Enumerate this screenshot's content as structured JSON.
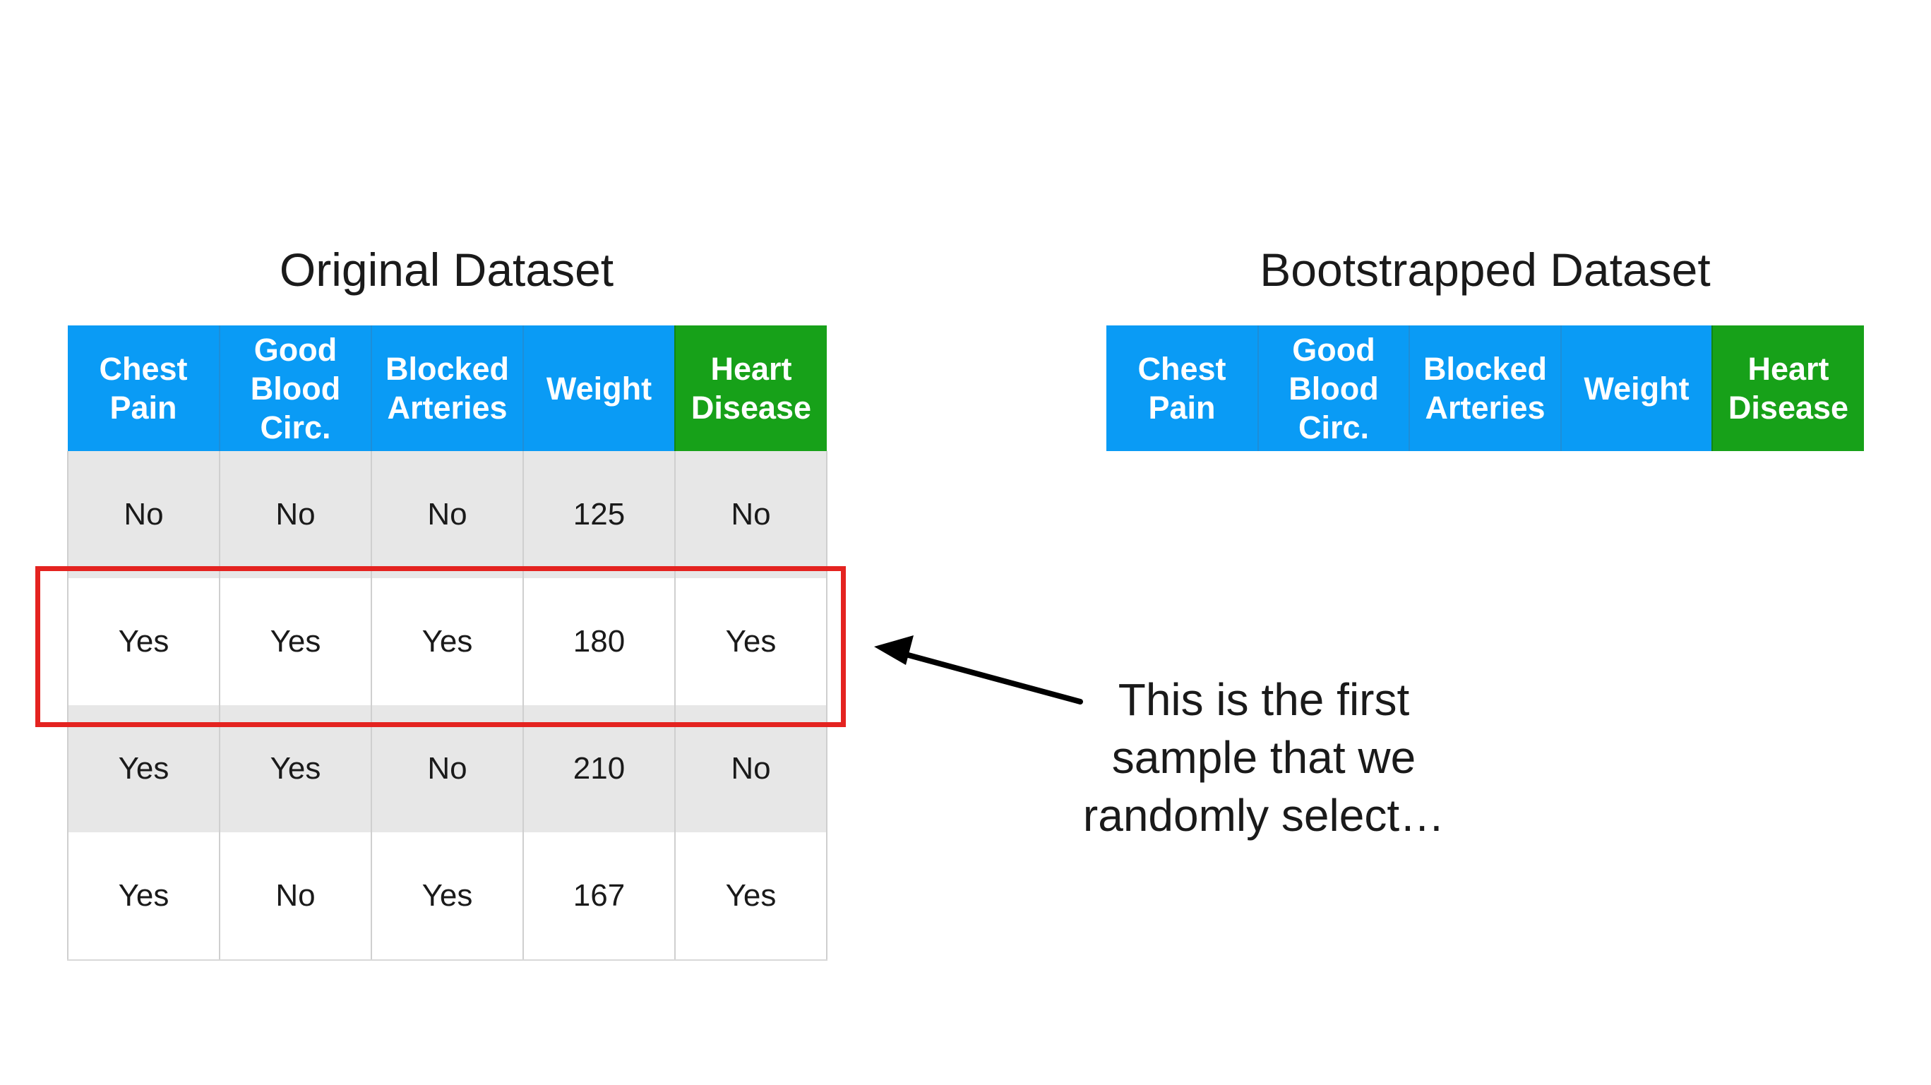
{
  "original": {
    "title": "Original Dataset",
    "headers": [
      "Chest\nPain",
      "Good\nBlood\nCirc.",
      "Blocked\nArteries",
      "Weight",
      "Heart\nDisease"
    ],
    "rows": [
      [
        "No",
        "No",
        "No",
        "125",
        "No"
      ],
      [
        "Yes",
        "Yes",
        "Yes",
        "180",
        "Yes"
      ],
      [
        "Yes",
        "Yes",
        "No",
        "210",
        "No"
      ],
      [
        "Yes",
        "No",
        "Yes",
        "167",
        "Yes"
      ]
    ]
  },
  "bootstrapped": {
    "title": "Bootstrapped Dataset",
    "headers": [
      "Chest\nPain",
      "Good\nBlood\nCirc.",
      "Blocked\nArteries",
      "Weight",
      "Heart\nDisease"
    ]
  },
  "annotation": {
    "lines": [
      "This is the first",
      "sample that we",
      "randomly select…"
    ]
  },
  "colors": {
    "header_blue": "#0a9bf5",
    "header_green": "#17a119",
    "highlight_red": "#e42320",
    "row_gray": "#e7e7e7"
  }
}
